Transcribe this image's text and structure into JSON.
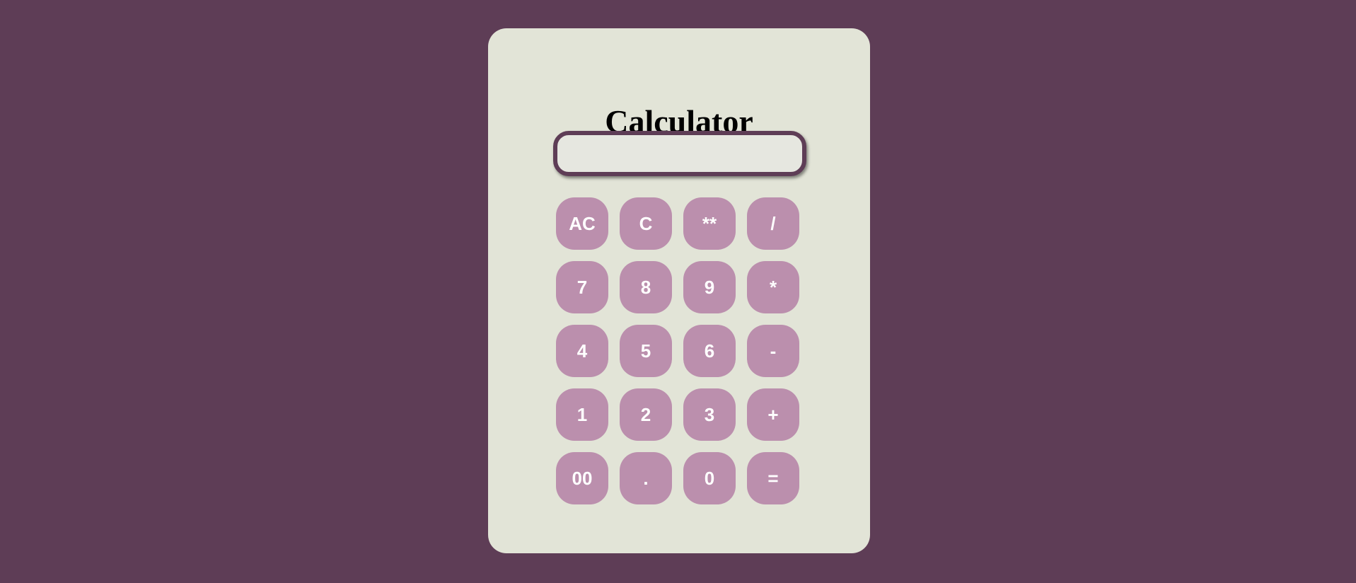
{
  "app": {
    "title": "Calculator"
  },
  "display": {
    "value": ""
  },
  "colors": {
    "background": "#5e3d56",
    "card": "#e2e4d7",
    "key": "#bb8fad",
    "key_text": "#ffffff",
    "display_border": "#5e3d56"
  },
  "keys": {
    "ac": "AC",
    "c": "C",
    "power": "**",
    "divide": "/",
    "seven": "7",
    "eight": "8",
    "nine": "9",
    "multiply": "*",
    "four": "4",
    "five": "5",
    "six": "6",
    "minus": "-",
    "one": "1",
    "two": "2",
    "three": "3",
    "plus": "+",
    "double_zero": "00",
    "dot": ".",
    "zero": "0",
    "equals": "="
  }
}
